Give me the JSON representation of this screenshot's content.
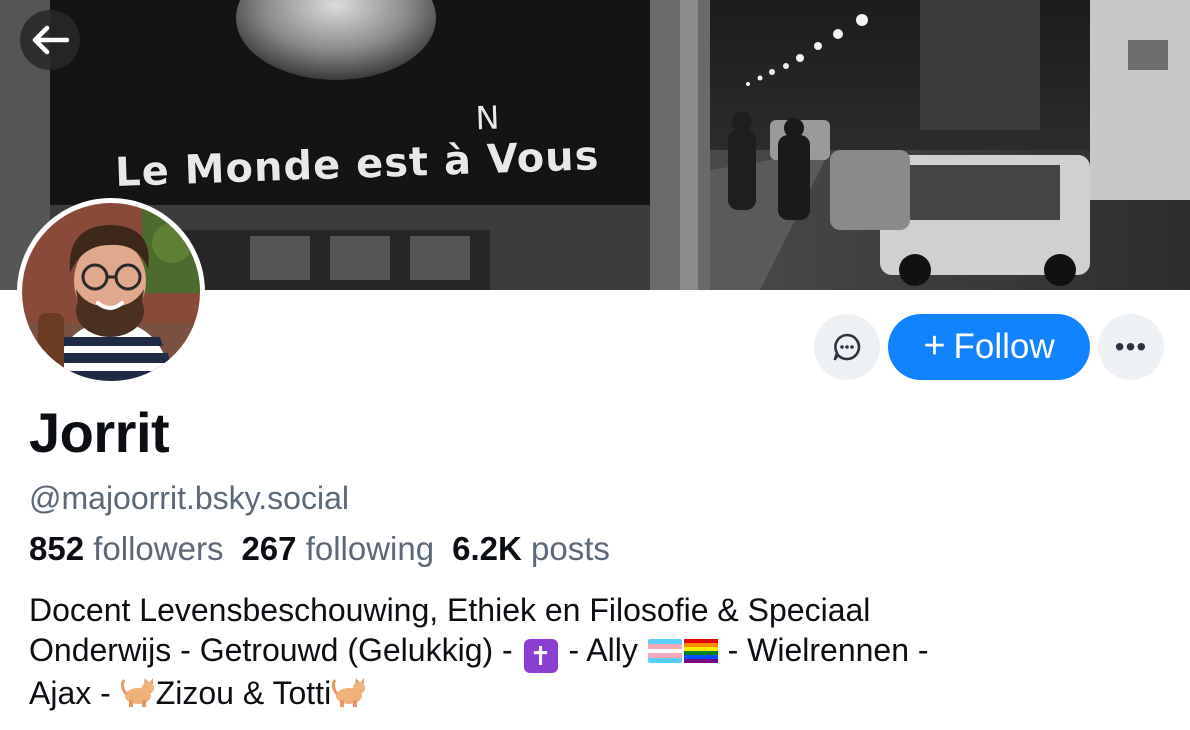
{
  "banner": {
    "caption": "Le Monde est à Vous",
    "caption_fix_letter": "N"
  },
  "profile": {
    "display_name": "Jorrit",
    "handle": "@majoorrit.bsky.social",
    "stats": {
      "followers_count": "852",
      "followers_label": "followers",
      "following_count": "267",
      "following_label": "following",
      "posts_count": "6.2K",
      "posts_label": "posts"
    },
    "bio": {
      "line1": "Docent Levensbeschouwing, Ethiek en Filosofie & Speciaal",
      "line2_a": "Onderwijs - Getrouwd (Gelukkig) - ",
      "line2_cross": "✝",
      "line2_b": " - Ally ",
      "line2_c": " - Wielrennen -",
      "line3_a": "Ajax - ",
      "line3_b": "Zizou & Totti"
    }
  },
  "actions": {
    "follow_plus": "+",
    "follow_label": "Follow",
    "more_label": "•••"
  },
  "icons": {
    "back": "arrow-left-icon",
    "message": "chat-bubble-icon",
    "more": "ellipsis-icon"
  },
  "colors": {
    "accent": "#1183fe",
    "secondary_text": "#5b6877",
    "button_bg": "#eef1f4"
  }
}
